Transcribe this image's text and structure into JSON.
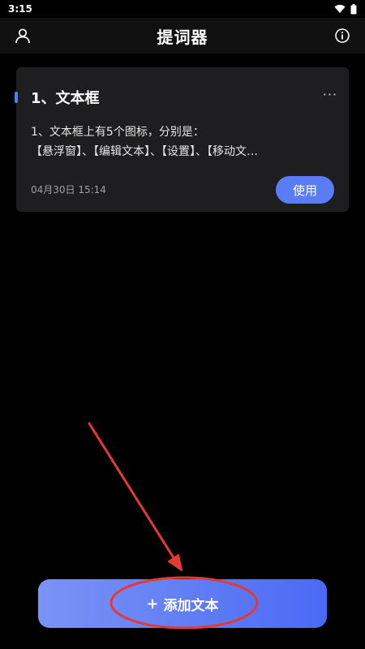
{
  "status_bar": {
    "time": "3:15"
  },
  "header": {
    "title": "提词器"
  },
  "card": {
    "title": "1、文本框",
    "more": "···",
    "body_line1": "1、文本框上有5个图标，分别是：",
    "body_line2": "【悬浮窗】、【编辑文本】、【设置】、【移动文…",
    "date": "04月30日 15:14",
    "use_label": "使用"
  },
  "add_button": {
    "plus": "+",
    "label": "添加文本"
  },
  "colors": {
    "accent": "#5b7cf7",
    "annotation": "#e53935",
    "background": "#000000",
    "card": "#1e1e20"
  }
}
